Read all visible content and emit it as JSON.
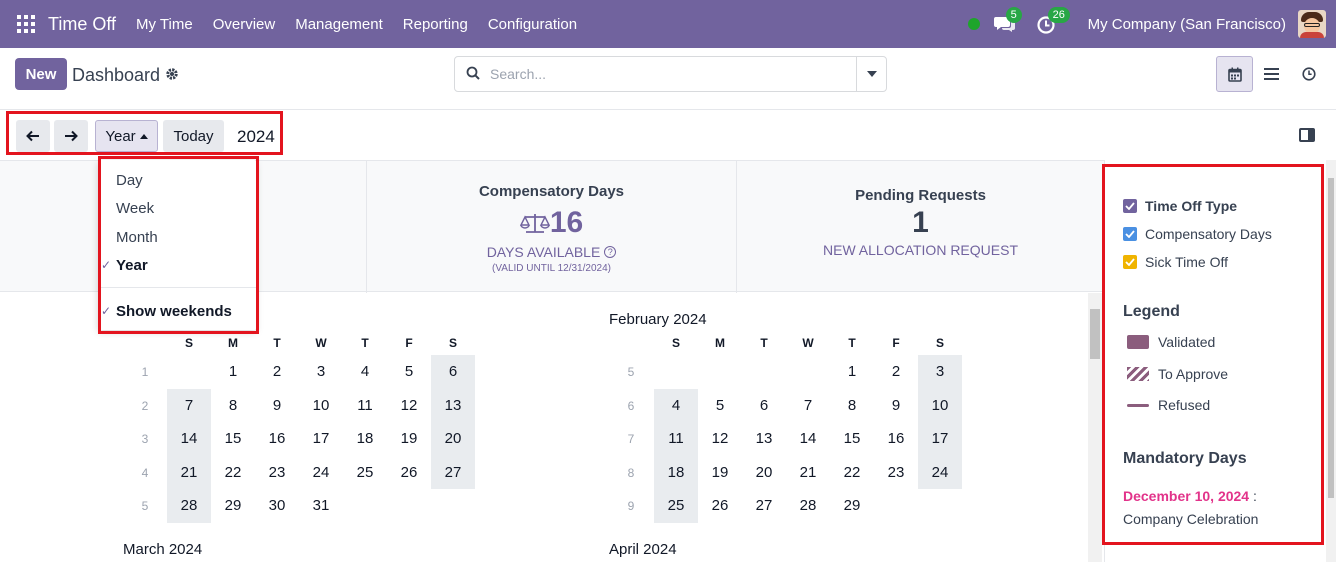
{
  "navbar": {
    "app_name": "Time Off",
    "menu": [
      "My Time",
      "Overview",
      "Management",
      "Reporting",
      "Configuration"
    ],
    "messages_badge": "5",
    "activity_badge": "26",
    "company": "My Company (San Francisco)"
  },
  "control": {
    "new_label": "New",
    "breadcrumb": "Dashboard",
    "search_placeholder": "Search..."
  },
  "calendar_controls": {
    "scale_label": "Year",
    "today_label": "Today",
    "year": "2024",
    "scale_options": [
      {
        "label": "Day",
        "selected": false
      },
      {
        "label": "Week",
        "selected": false
      },
      {
        "label": "Month",
        "selected": false
      },
      {
        "label": "Year",
        "selected": true
      }
    ],
    "show_weekends_label": "Show weekends",
    "show_weekends_checked": true
  },
  "dashboard": {
    "compensatory": {
      "title": "Compensatory Days",
      "value": "16",
      "subtitle": "DAYS AVAILABLE",
      "validity": "(VALID UNTIL 12/31/2024)"
    },
    "pending": {
      "title": "Pending Requests",
      "value": "1",
      "subtitle": "NEW ALLOCATION REQUEST"
    }
  },
  "months": [
    {
      "title": "",
      "weekdays": [
        "S",
        "M",
        "T",
        "W",
        "T",
        "F",
        "S"
      ],
      "weeks": [
        {
          "num": "1",
          "days": [
            "",
            "1",
            "2",
            "3",
            "4",
            "5",
            "6"
          ]
        },
        {
          "num": "2",
          "days": [
            "7",
            "8",
            "9",
            "10",
            "11",
            "12",
            "13"
          ]
        },
        {
          "num": "3",
          "days": [
            "14",
            "15",
            "16",
            "17",
            "18",
            "19",
            "20"
          ]
        },
        {
          "num": "4",
          "days": [
            "21",
            "22",
            "23",
            "24",
            "25",
            "26",
            "27"
          ]
        },
        {
          "num": "5",
          "days": [
            "28",
            "29",
            "30",
            "31",
            "",
            "",
            ""
          ]
        }
      ]
    },
    {
      "title": "February 2024",
      "weekdays": [
        "S",
        "M",
        "T",
        "W",
        "T",
        "F",
        "S"
      ],
      "weeks": [
        {
          "num": "5",
          "days": [
            "",
            "",
            "",
            "",
            "1",
            "2",
            "3"
          ]
        },
        {
          "num": "6",
          "days": [
            "4",
            "5",
            "6",
            "7",
            "8",
            "9",
            "10"
          ]
        },
        {
          "num": "7",
          "days": [
            "11",
            "12",
            "13",
            "14",
            "15",
            "16",
            "17"
          ]
        },
        {
          "num": "8",
          "days": [
            "18",
            "19",
            "20",
            "21",
            "22",
            "23",
            "24"
          ]
        },
        {
          "num": "9",
          "days": [
            "25",
            "26",
            "27",
            "28",
            "29",
            "",
            ""
          ]
        }
      ]
    }
  ],
  "next_months": [
    "March 2024",
    "April 2024"
  ],
  "sidebar": {
    "filters": [
      {
        "label": "Time Off Type",
        "color": "#71639e",
        "bold": true
      },
      {
        "label": "Compensatory Days",
        "color": "#4a90e2",
        "bold": false
      },
      {
        "label": "Sick Time Off",
        "color": "#f0b400",
        "bold": false
      }
    ],
    "legend_title": "Legend",
    "legend": [
      {
        "label": "Validated",
        "style": "solid",
        "color": "#8b5d7d"
      },
      {
        "label": "To Approve",
        "style": "striped",
        "color": "#8b5d7d"
      },
      {
        "label": "Refused",
        "style": "line",
        "color": "#8b5d7d"
      }
    ],
    "mandatory_title": "Mandatory Days",
    "mandatory_date": "December 10, 2024",
    "mandatory_sep": " :",
    "mandatory_name": "Company Celebration"
  }
}
